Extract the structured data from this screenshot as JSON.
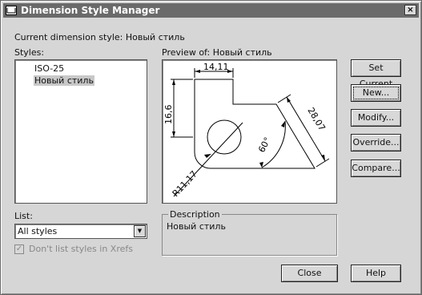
{
  "window": {
    "title": "Dimension Style Manager",
    "close_glyph": "×"
  },
  "current_style": {
    "label": "Current dimension style:",
    "value": "Новый стиль"
  },
  "styles": {
    "label": "Styles:",
    "items": [
      "ISO-25",
      "Новый стиль"
    ],
    "selected_index": 1
  },
  "preview": {
    "label": "Preview of:",
    "style_name": "Новый стиль",
    "dims": {
      "horizontal": "14,11",
      "vertical": "16,6",
      "aligned": "28,07",
      "angle": "60°",
      "radius": "R11,17"
    }
  },
  "list_filter": {
    "label": "List:",
    "selected": "All styles"
  },
  "xrefs_checkbox": {
    "label": "Don't list styles in Xrefs",
    "checked": true,
    "enabled": false
  },
  "description": {
    "legend": "Description",
    "text": "Новый стиль"
  },
  "buttons": {
    "set_current": "Set Current",
    "new": "New...",
    "modify": "Modify...",
    "override": "Override...",
    "compare": "Compare...",
    "close": "Close",
    "help": "Help"
  }
}
